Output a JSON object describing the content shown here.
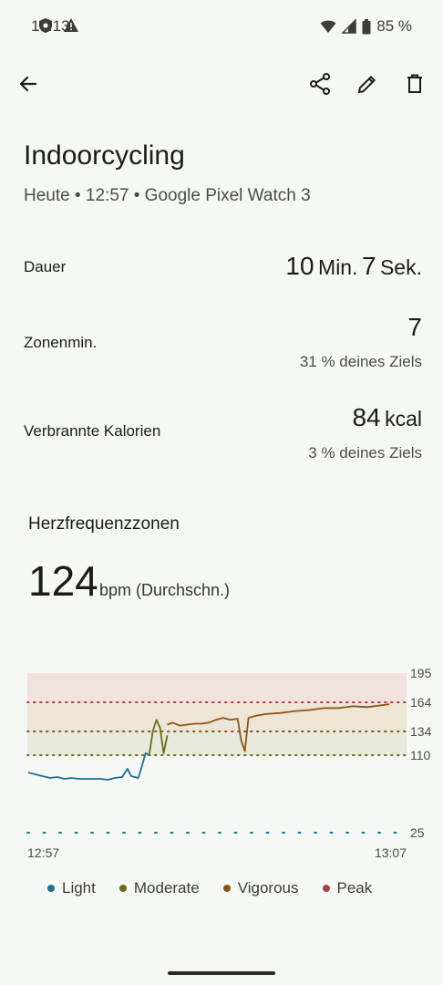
{
  "status_bar": {
    "time": "13:13",
    "battery": "85 %",
    "icons": [
      "shield-icon",
      "warning-icon",
      "wifi-icon",
      "cellular-signal-icon",
      "battery-icon"
    ]
  },
  "toolbar": {
    "icons": [
      "back-arrow-icon",
      "share-icon",
      "edit-pencil-icon",
      "delete-trash-icon"
    ]
  },
  "activity": {
    "title": "Indoorcycling",
    "subtitle": "Heute • 12:57 • Google Pixel Watch 3"
  },
  "stats": {
    "duration": {
      "label": "Dauer",
      "minutes": "10",
      "min_unit": "Min.",
      "seconds": "7",
      "sec_unit": "Sek."
    },
    "zone_minutes": {
      "label": "Zonenmin.",
      "value": "7",
      "sub": "31 % deines Ziels"
    },
    "calories": {
      "label": "Verbrannte Kalorien",
      "value": "84",
      "unit": "kcal",
      "sub": "3 % deines Ziels"
    }
  },
  "heart_rate": {
    "section_title": "Herzfrequenzzonen",
    "average_value": "124",
    "average_unit": "bpm (Durchschn.)"
  },
  "chart_data": {
    "type": "line",
    "y_ticks": [
      "195",
      "164",
      "134",
      "110",
      "25"
    ],
    "x_ticks": [
      "12:57",
      "13:07"
    ],
    "ylim": [
      25,
      195
    ],
    "zone_thresholds": [
      110,
      134,
      164,
      195
    ],
    "series": [
      {
        "name": "Light",
        "color": "#1f6e96",
        "x": [
          0,
          0.2,
          0.4,
          0.6,
          0.8,
          1.0,
          1.2,
          1.4,
          1.6,
          1.8,
          2.0,
          2.2,
          2.4,
          2.6,
          2.75,
          2.85,
          2.95,
          3.05,
          3.15,
          3.25,
          3.35
        ],
        "y": [
          91,
          89,
          87,
          85,
          86,
          84,
          85,
          84,
          84,
          84,
          84,
          83,
          85,
          86,
          95,
          87,
          86,
          85,
          98,
          112,
          110
        ]
      },
      {
        "name": "Moderate",
        "color": "#6b6e10",
        "x": [
          3.35,
          3.45,
          3.55,
          3.65,
          3.75,
          3.85
        ],
        "y": [
          110,
          134,
          146,
          138,
          112,
          130
        ]
      },
      {
        "name": "Vigorous",
        "color": "#8c5416",
        "x": [
          3.85,
          4.0,
          4.2,
          4.4,
          4.6,
          4.8,
          5.0,
          5.2,
          5.4,
          5.6,
          5.8,
          5.9,
          6.0,
          6.1,
          6.3,
          6.6,
          7.0,
          7.4,
          7.8,
          8.2,
          8.6,
          9.0,
          9.4,
          9.8,
          10.0
        ],
        "y": [
          141,
          143,
          140,
          141,
          142,
          142,
          143,
          146,
          148,
          146,
          147,
          125,
          114,
          148,
          150,
          152,
          153,
          155,
          156,
          158,
          158,
          160,
          159,
          161,
          162
        ]
      }
    ],
    "legend": [
      {
        "name": "Light",
        "color": "#1f6e96"
      },
      {
        "name": "Moderate",
        "color": "#6b6e10"
      },
      {
        "name": "Vigorous",
        "color": "#8c5416"
      },
      {
        "name": "Peak",
        "color": "#b0423f"
      }
    ]
  }
}
